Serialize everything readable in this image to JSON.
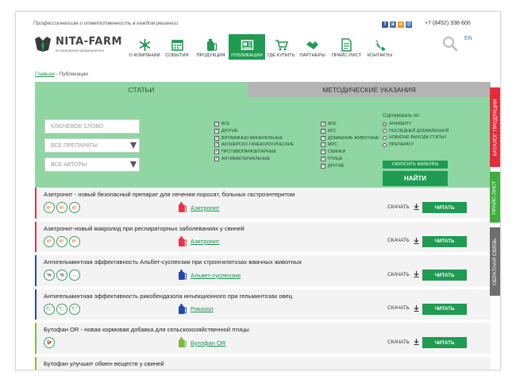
{
  "header": {
    "slogan": "Профессионализм и ответственность в каждом решении",
    "logo_name": "NITA-FARM",
    "logo_sub": "ветеринарная фармацевтика",
    "phone": "+7 (8452) 338-600",
    "lang": "EN",
    "socials": [
      {
        "icon": "facebook-icon",
        "glyph": "f",
        "color": "#3b5998"
      },
      {
        "icon": "vk-icon",
        "glyph": "в",
        "color": "#4c75a3"
      },
      {
        "icon": "odnoklassniki-icon",
        "glyph": "о",
        "color": "#f7931e"
      },
      {
        "icon": "mail-icon",
        "glyph": "@",
        "color": "#2b6dad"
      }
    ]
  },
  "nav": [
    {
      "label": "О КОМПАНИИ",
      "icon": "snowflake-icon"
    },
    {
      "label": "СОБЫТИЯ",
      "icon": "calendar-icon"
    },
    {
      "label": "ПРОДУКЦИЯ",
      "icon": "bottle-icon"
    },
    {
      "label": "ПУБЛИКАЦИИ",
      "icon": "newspaper-icon",
      "active": true
    },
    {
      "label": "ГДЕ КУПИТЬ",
      "icon": "cart-icon"
    },
    {
      "label": "ПАРТНЕРЫ",
      "icon": "handshake-icon"
    },
    {
      "label": "ПРАЙС-ЛИСТ",
      "icon": "document-icon"
    },
    {
      "label": "КОНТАКТЫ",
      "icon": "phone-icon"
    }
  ],
  "breadcrumb": {
    "home": "Главная",
    "sep": " - ",
    "current": "Публикации"
  },
  "tabs": {
    "articles": "СТАТЬИ",
    "guidelines": "МЕТОДИЧЕСКИЕ УКАЗАНИЯ"
  },
  "filters": {
    "keyword_placeholder": "КЛЮЧЕВОЕ СЛОВО",
    "drugs_select": "ВСЕ ПРЕПАРАТЫ",
    "authors_select": "ВСЕ АВТОРЫ",
    "groups": [
      {
        "label": "ВСЕ",
        "checked": true
      },
      {
        "label": "ДРУГИЕ",
        "checked": true
      },
      {
        "label": "ВИТАМИННО-МИНЕРАЛЬНЫЕ",
        "checked": true
      },
      {
        "label": "АКУШЕРСКО-ГИНЕКОЛОГИЧЕСКИЕ",
        "checked": true
      },
      {
        "label": "ПРОТИВОПАРАЗИТАРНЫЕ",
        "checked": true
      },
      {
        "label": "АНТИБАКТЕРИАЛЬНЫЕ",
        "checked": true
      }
    ],
    "animals": [
      {
        "label": "ВСЕ",
        "checked": true
      },
      {
        "label": "КРС",
        "checked": true
      },
      {
        "label": "ДОМАШНИЕ ЖИВОТНЫЕ",
        "checked": true
      },
      {
        "label": "МРС",
        "checked": true
      },
      {
        "label": "СВИНЬИ",
        "checked": true
      },
      {
        "label": "ПТИЦА",
        "checked": true
      },
      {
        "label": "ДРУГИЕ",
        "checked": true
      }
    ],
    "sort_title": "Сортировать по:",
    "sort_options": [
      {
        "label": "АЛФАВИТУ",
        "selected": true
      },
      {
        "label": "ПОСЛЕДНЕЙ ДОБАВЛЕННОЙ",
        "selected": false
      },
      {
        "label": "НОВИЗНЕ ВЫХОДА СТАТЬИ",
        "selected": false
      },
      {
        "label": "ПРЕПАРАТУ",
        "selected": false
      }
    ],
    "reset_label": "СБРОСИТЬ ФИЛЬТРЫ",
    "find_label": "НАЙТИ"
  },
  "publications": [
    {
      "title": "Азитронит - новый безопасный препарат для лечения поросят, больных гастроэнтеритом",
      "color": "#e8334a",
      "animals": [
        "pig-icon",
        "pig-icon",
        "pig-icon"
      ],
      "product": "Азитронит",
      "product_color": "#e8334a"
    },
    {
      "title": "Азитронит-новый макролид при респираторных заболеваниях у свиней",
      "color": "#e8334a",
      "animals": [
        "pig-icon",
        "pig-icon",
        "pig-icon"
      ],
      "product": "Азитронит",
      "product_color": "#e8334a"
    },
    {
      "title": "Антигельминтная эффективность Альбет-суспензии при стронгилятозах жвачных животных",
      "color": "#2449a8",
      "animals": [
        "cow-icon",
        "cow-icon",
        "more-icon"
      ],
      "product": "Альвет-суспензия",
      "product_color": "#2449a8"
    },
    {
      "title": "Антигельминтная эффективность рикобендазола инъекционного при гельминтозах овец",
      "color": "#2449a8",
      "animals": [
        "sheep-icon",
        "sheep-icon",
        "sheep-icon"
      ],
      "product": "Риказол",
      "product_color": "#2449a8"
    },
    {
      "title": "Бутофан OR - новая кормовая добавка для сельскохозяйственной птицы",
      "color": "#7dbb3a",
      "animals": [
        "bird-icon"
      ],
      "product": "Бутофан OR",
      "product_color": "#7dbb3a"
    },
    {
      "title": "Бутофан улучшит обмен веществ у свиней",
      "color": "#7dbb3a",
      "animals": [],
      "product": "",
      "product_color": "#7dbb3a"
    }
  ],
  "row_actions": {
    "download": "СКАЧАТЬ",
    "read": "ЧИТАТЬ"
  },
  "side_tabs": [
    {
      "label": "КАТАЛОГ ПРОДУКЦИИ",
      "color": "#e52b3b"
    },
    {
      "label": "ПРАЙС-ЛИСТ",
      "color": "#3fae3f"
    },
    {
      "label": "ОБРАТНАЯ СВЯЗЬ",
      "color": "#6e6e6e"
    }
  ]
}
